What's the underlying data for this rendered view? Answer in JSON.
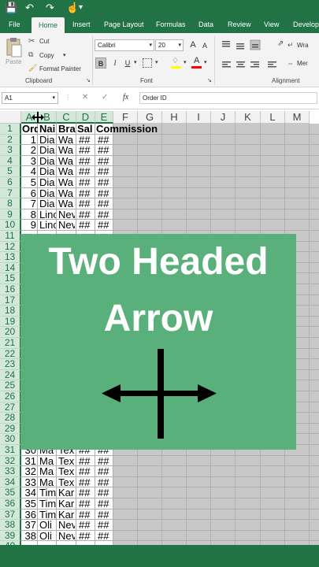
{
  "ribbon_tabs": [
    "File",
    "Home",
    "Insert",
    "Page Layout",
    "Formulas",
    "Data",
    "Review",
    "View",
    "Develop"
  ],
  "clipboard": {
    "paste": "Paste",
    "cut": "Cut",
    "copy": "Copy",
    "format_painter": "Format Painter",
    "label": "Clipboard"
  },
  "font": {
    "name": "Calibri",
    "size": "20",
    "bold": "B",
    "italic": "I",
    "underline": "U",
    "grow": "A",
    "shrink": "A",
    "label": "Font"
  },
  "alignment": {
    "wrap": "Wra",
    "merge": "Mer",
    "label": "Alignment"
  },
  "formula_bar": {
    "name_box": "A1",
    "fx": "fx",
    "content": "Order ID"
  },
  "columns": [
    "A",
    "B",
    "C",
    "D",
    "E",
    "F",
    "G",
    "H",
    "I",
    "J",
    "K",
    "L",
    "M"
  ],
  "header_row": [
    "Ord",
    "Nai",
    "Bra",
    "Sal",
    "Commission"
  ],
  "rows_top": [
    [
      "1",
      "Dia",
      "Wa",
      "##",
      "##"
    ],
    [
      "2",
      "Dia",
      "Wa",
      "##",
      "##"
    ],
    [
      "3",
      "Dia",
      "Wa",
      "##",
      "##"
    ],
    [
      "4",
      "Dia",
      "Wa",
      "##",
      "##"
    ],
    [
      "5",
      "Dia",
      "Wa",
      "##",
      "##"
    ],
    [
      "6",
      "Dia",
      "Wa",
      "##",
      "##"
    ],
    [
      "7",
      "Dia",
      "Wa",
      "##",
      "##"
    ],
    [
      "8",
      "Linc",
      "Nev",
      "##",
      "##"
    ],
    [
      "9",
      "Linc",
      "Nev",
      "##",
      "##"
    ]
  ],
  "rows_bottom": [
    [
      "30",
      "Ma",
      "Tex",
      "##",
      "##"
    ],
    [
      "31",
      "Ma",
      "Tex",
      "##",
      "##"
    ],
    [
      "32",
      "Ma",
      "Tex",
      "##",
      "##"
    ],
    [
      "33",
      "Ma",
      "Tex",
      "##",
      "##"
    ],
    [
      "34",
      "Tim",
      "Kar",
      "##",
      "##"
    ],
    [
      "35",
      "Tim",
      "Kar",
      "##",
      "##"
    ],
    [
      "36",
      "Tim",
      "Kar",
      "##",
      "##"
    ],
    [
      "37",
      "Oli",
      "Nev",
      "##",
      "##"
    ],
    [
      "38",
      "Oli",
      "Nev",
      "##",
      "##"
    ]
  ],
  "overlay": {
    "line1": "Two Headed",
    "line2": "Arrow",
    "color": "#5ab07a"
  },
  "accent_color": "#217346"
}
